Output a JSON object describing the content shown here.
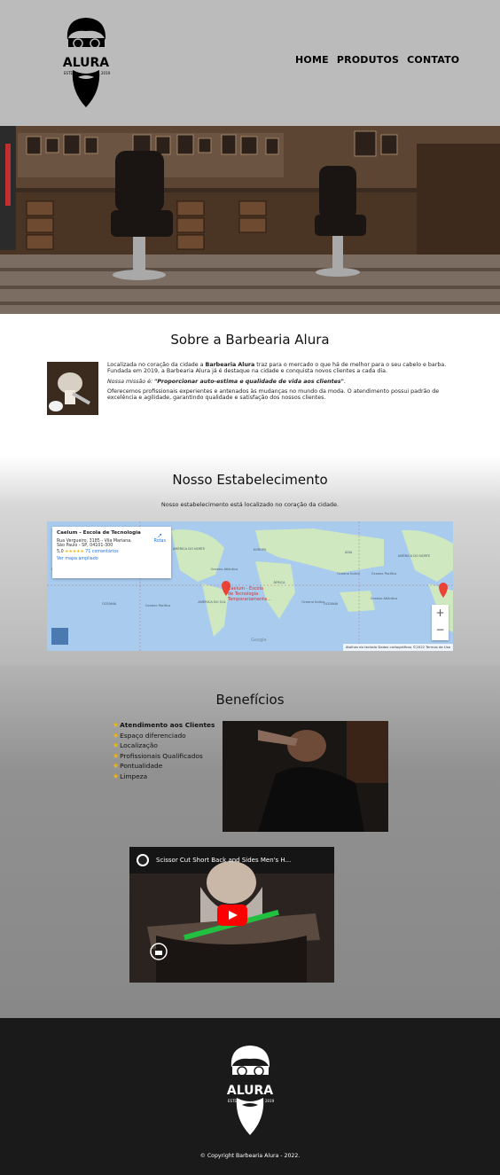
{
  "header": {
    "logo": {
      "text": "ALURA",
      "estd": "ESTD",
      "year": "2019"
    },
    "nav": [
      {
        "label": "HOME"
      },
      {
        "label": "PRODUTOS"
      },
      {
        "label": "CONTATO"
      }
    ]
  },
  "sobre": {
    "title": "Sobre a Barbearia Alura",
    "p1_before": "Localizada no coração da cidade a ",
    "p1_bold": "Barbearia Alura",
    "p1_after": " traz para o mercado o que há de melhor para o seu cabelo e barba. Fundada em 2019, a Barbearia Alura já é destaque na cidade e conquista novos clientes a cada dia.",
    "p2_label": "Nossa missão é: ",
    "p2_bold": "\"Proporcionar auto-estima e qualidade de vida aos clientes\"",
    "p2_end": ".",
    "p3": "Oferecemos profissionais experientes e antenados às mudanças no mundo da moda. O atendimento possui padrão de excelência e agilidade, garantindo qualidade e satisfação dos nossos clientes."
  },
  "estabelecimento": {
    "title": "Nosso Estabelecimento",
    "description": "Nosso estabelecimento está localizado no coração da cidade.",
    "map": {
      "place_name": "Caelum - Escola de Tecnologia",
      "address_line1": "Rua Vergueiro, 3185 - Vila Mariana,",
      "address_line2": "São Paulo - SP, 04101-300",
      "rating": "5,0",
      "stars": "★★★★★",
      "reviews": "71 comentários",
      "larger_map": "Ver mapa ampliado",
      "directions": "Rotas",
      "pin_label_1": "Caelum - Escola",
      "pin_label_2": "de Tecnologia",
      "pin_label_3": "Temporariamente...",
      "zoom_in": "+",
      "zoom_out": "−",
      "footer": "Atalhos do teclado   Dados cartográficos ©2022   Termos de Uso",
      "google": "Google",
      "regions": [
        {
          "name": "AMÉRICA DO NORTE"
        },
        {
          "name": "EUROPA"
        },
        {
          "name": "ÁSIA"
        },
        {
          "name": "ÁFRICA"
        },
        {
          "name": "AMÉRICA DO SUL"
        },
        {
          "name": "OCEANIA"
        },
        {
          "name": "AMÉRICA DO NORTE"
        },
        {
          "name": "Oceano Atlântico"
        },
        {
          "name": "Oceano Pacífico"
        },
        {
          "name": "Oceano Índico"
        },
        {
          "name": "Oceano Pacífico"
        },
        {
          "name": "Oceano Atlântico"
        },
        {
          "name": "OCEANIA"
        },
        {
          "name": "Oceano Índico"
        },
        {
          "name": "Oceano Pacífico"
        },
        {
          "name": "Oceano Atlântico"
        }
      ]
    }
  },
  "beneficios": {
    "title": "Benefícios",
    "items": [
      {
        "label": "Atendimento aos Clientes",
        "bold": true
      },
      {
        "label": "Espaço diferenciado",
        "bold": false
      },
      {
        "label": "Localização",
        "bold": false
      },
      {
        "label": "Profissionais Qualificados",
        "bold": false
      },
      {
        "label": "Pontualidade",
        "bold": false
      },
      {
        "label": "Limpeza",
        "bold": false
      }
    ],
    "video_title": "Scissor Cut Short Back and Sides Men's H..."
  },
  "footer": {
    "logo_text": "ALURA",
    "estd": "ESTD",
    "year": "2019",
    "copyright": "© Copyright Barbearia Alura - 2022."
  },
  "colors": {
    "header_bg": "#bbbbbb",
    "footer_bg": "#1a1a1a",
    "star": "#f5b800",
    "map_water": "#a8cbee",
    "map_land": "#cfe8bf",
    "youtube_red": "#ff0000"
  }
}
